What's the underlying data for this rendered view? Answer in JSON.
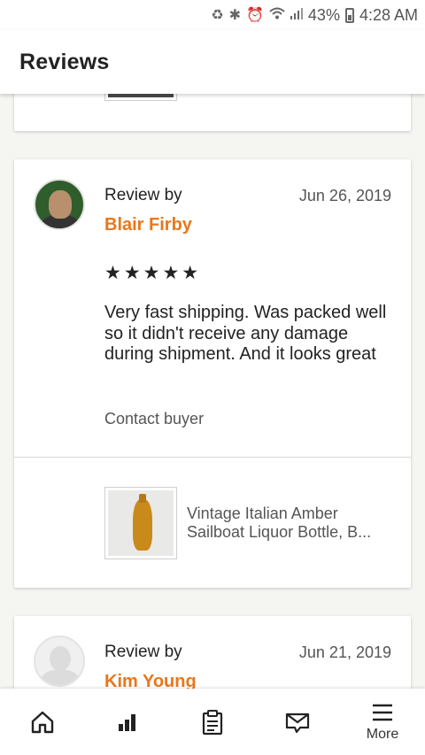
{
  "status_bar": {
    "battery": "43%",
    "time": "4:28 AM",
    "icons": [
      "recycle-icon",
      "bluetooth-icon",
      "alarm-icon",
      "wifi-icon",
      "signal-icon",
      "battery-icon"
    ]
  },
  "app_bar": {
    "title": "Reviews"
  },
  "reviews": [
    {
      "review_by_label": "Review by",
      "reviewer": "Blair Firby",
      "date": "Jun 26, 2019",
      "stars": "★★★★★",
      "text": "Very fast shipping.  Was packed well so it didn't receive any damage during shipment.  And it looks great",
      "contact": "Contact buyer",
      "product_title": "Vintage Italian Amber Sailboat Liquor Bottle, B..."
    },
    {
      "review_by_label": "Review by",
      "reviewer": "Kim Young",
      "date": "Jun 21, 2019"
    }
  ],
  "bottom_nav": {
    "items": [
      {
        "icon": "home-icon"
      },
      {
        "icon": "stats-icon"
      },
      {
        "icon": "orders-icon"
      },
      {
        "icon": "messages-icon"
      },
      {
        "icon": "menu-icon",
        "label": "More"
      }
    ]
  },
  "colors": {
    "accent": "#e8771c",
    "background": "#f5f5f1"
  }
}
